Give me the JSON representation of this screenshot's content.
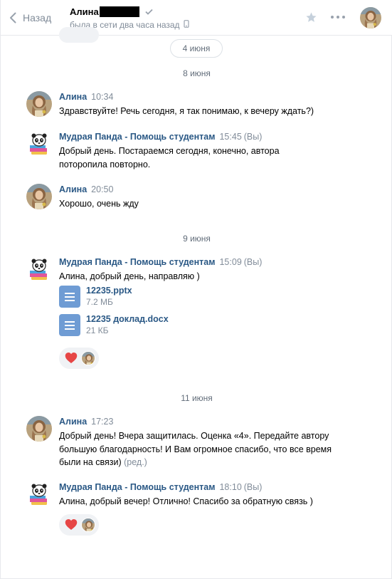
{
  "header": {
    "back_label": "Назад",
    "peer_name": "Алина",
    "peer_status": "была в сети два часа назад"
  },
  "date_pill": "4 июня",
  "dates": {
    "d1": "8 июня",
    "d2": "9 июня",
    "d3": "11 июня"
  },
  "messages": [
    {
      "author": "Алина",
      "time": "10:34",
      "you": "",
      "text": "Здравствуйте! Речь сегодня, я так понимаю, к вечеру ждать?)"
    },
    {
      "author": "Мудрая Панда - Помощь студентам",
      "time": "15:45",
      "you": "(Вы)",
      "text": "Добрый день. Постараемся сегодня, конечно, автора поторопила повторно."
    },
    {
      "author": "Алина",
      "time": "20:50",
      "you": "",
      "text": "Хорошо, очень жду"
    },
    {
      "author": "Мудрая Панда - Помощь студентам",
      "time": "15:09",
      "you": "(Вы)",
      "text": "Алина, добрый день, направляю )"
    },
    {
      "author": "Алина",
      "time": "17:23",
      "you": "",
      "text": "Добрый день! Вчера защитилась. Оценка «4». Передайте автору большую благодарность! И Вам огромное спасибо, что все время были на связи)",
      "edited": "(ред.)"
    },
    {
      "author": "Мудрая Панда - Помощь студентам",
      "time": "18:10",
      "you": "(Вы)",
      "text": "Алина, добрый вечер! Отлично! Спасибо за обратную связь )"
    }
  ],
  "attachments": [
    {
      "name": "12235.pptx",
      "size": "7.2 МБ"
    },
    {
      "name": "12235 доклад.docx",
      "size": "21 КБ"
    }
  ],
  "colors": {
    "link": "#2a5885",
    "secondary": "#818c99",
    "doc_icon": "#6f9cd4",
    "heart": "#e64646",
    "reaction_bg": "#f0f2f5"
  },
  "icons": [
    "back-chevron-icon",
    "verified-check-icon",
    "mobile-phone-icon",
    "star-icon",
    "more-dots-icon",
    "document-icon",
    "heart-icon"
  ]
}
